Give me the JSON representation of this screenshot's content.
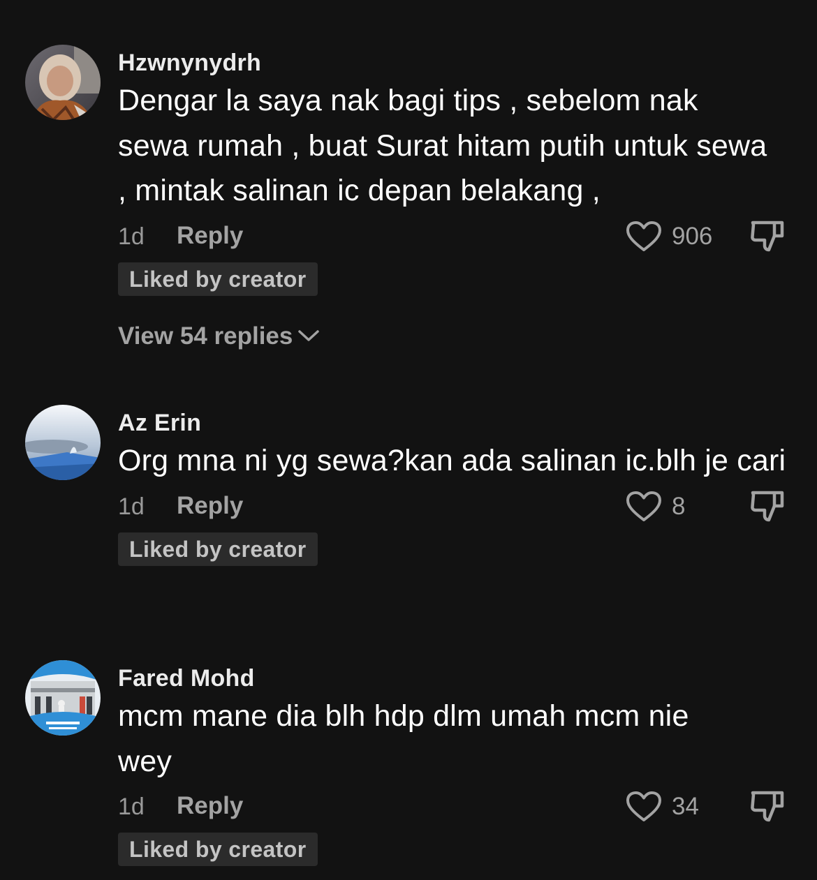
{
  "comments": [
    {
      "username": "Hzwnynydrh",
      "text": "Dengar la saya nak bagi tips , sebelom nak sewa rumah , buat Surat hitam putih untuk sewa , mintak salinan ic depan belakang ,",
      "time": "1d",
      "reply_label": "Reply",
      "likes": "906",
      "badge": "Liked by creator",
      "view_replies": "View 54 replies"
    },
    {
      "username": "Az Erin",
      "text": "Org mna ni yg sewa?kan ada salinan ic.blh je cari",
      "time": "1d",
      "reply_label": "Reply",
      "likes": "8",
      "badge": "Liked by creator"
    },
    {
      "username": "Fared Mohd",
      "text": "mcm mane dia blh hdp dlm umah mcm nie wey",
      "time": "1d",
      "reply_label": "Reply",
      "likes": "34",
      "badge": "Liked by creator"
    }
  ],
  "colors": {
    "background": "#121212",
    "username": "#ececec",
    "secondary_text": "#a3a3a3",
    "badge_bg": "#2b2b2b"
  },
  "icons": {
    "like": "heart-outline-icon",
    "dislike": "thumbs-down-outline-icon",
    "expand": "chevron-down-icon"
  }
}
